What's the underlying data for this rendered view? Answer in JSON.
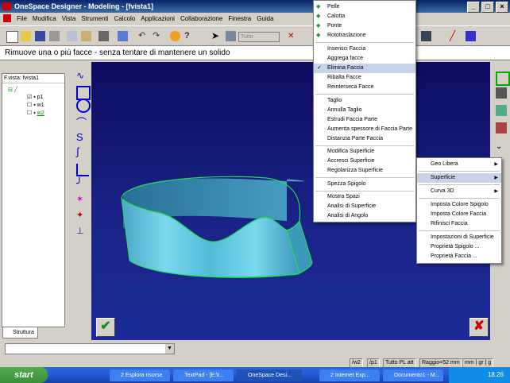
{
  "window": {
    "title": "OneSpace Designer - Modeling - [fvista1]",
    "controls": [
      "_",
      "□",
      "×"
    ]
  },
  "menubar": [
    "File",
    "Modifica",
    "Vista",
    "Strumenti",
    "Calcolo",
    "Applicazioni",
    "Collaborazione",
    "Finestra",
    "Guida"
  ],
  "toolbar": {
    "combo_value": "Tutto"
  },
  "prompt": "Rimuove una o più facce - senza tentare di mantenere un solido",
  "tree": {
    "header": "F.vista: fvista1",
    "items": [
      {
        "label": "p1"
      },
      {
        "label": "w1"
      },
      {
        "label": "w2"
      }
    ],
    "tab_label": "Struttura"
  },
  "surface_menu": {
    "items": [
      {
        "label": "Pelle",
        "selected": false
      },
      {
        "label": "Calotta",
        "selected": false
      },
      {
        "label": "Ponte",
        "selected": false
      },
      {
        "label": "Rototraslazione",
        "selected": false
      },
      {
        "label": "Inserisci Faccia",
        "selected": false
      },
      {
        "label": "Aggrega facce",
        "selected": false
      },
      {
        "label": "Elimina Faccia",
        "selected": true
      },
      {
        "label": "Ribalta Facce",
        "selected": false
      },
      {
        "label": "Reinterseca Facce",
        "selected": false
      },
      {
        "label": "Taglio",
        "selected": false
      },
      {
        "label": "Annulla Taglio",
        "selected": false
      },
      {
        "label": "Estrudi Faccia Parte",
        "selected": false
      },
      {
        "label": "Aumenta spessore di Faccia Parte",
        "selected": false
      },
      {
        "label": "Distanzia Parte Faccia",
        "selected": false
      },
      {
        "label": "Modifica Superficie",
        "selected": false
      },
      {
        "label": "Accresci Superficie",
        "selected": false
      },
      {
        "label": "Regolarizza Superficie",
        "selected": false
      },
      {
        "label": "Spezza Spigolo",
        "selected": false
      },
      {
        "label": "Mostra Spazi",
        "selected": false
      },
      {
        "label": "Analisi di Superficie",
        "selected": false
      },
      {
        "label": "Analisi di Angolo",
        "selected": false
      }
    ]
  },
  "context_menu": {
    "items": [
      {
        "label": "Geo Libera",
        "submenu": true
      },
      {
        "label": "Superficie",
        "submenu": true,
        "selected": true
      },
      {
        "label": "Curva 3D",
        "submenu": true
      },
      {
        "label": "Imposta Colore Spigolo"
      },
      {
        "label": "Imposta Colore Faccia"
      },
      {
        "label": "Rifinisci Faccia"
      },
      {
        "label": "Impostazioni di Superficie"
      },
      {
        "label": "Proprietà Spigolo ..."
      },
      {
        "label": "Proprietà Faccia ..."
      }
    ]
  },
  "statusbar": {
    "fields": [
      "/w2",
      "/p1",
      "Tutto PL att",
      "Raggio=52 mm",
      "mm | gr | g"
    ]
  },
  "taskbar": {
    "start": "start",
    "tasks": [
      {
        "label": "2 Esplora risorse",
        "active": false
      },
      {
        "label": "TextPad - [E:\\t...",
        "active": false
      },
      {
        "label": "OneSpace Desi...",
        "active": true
      },
      {
        "label": "2 Internet Exp...",
        "active": false
      },
      {
        "label": "Documento1 - M...",
        "active": false
      }
    ],
    "clock": "18.26"
  },
  "colors": {
    "viewport_bg": "#1a2488",
    "model_face": "#5ec8e0",
    "model_edge": "#22dd55",
    "menu_highlight": "#c7d3e8"
  }
}
